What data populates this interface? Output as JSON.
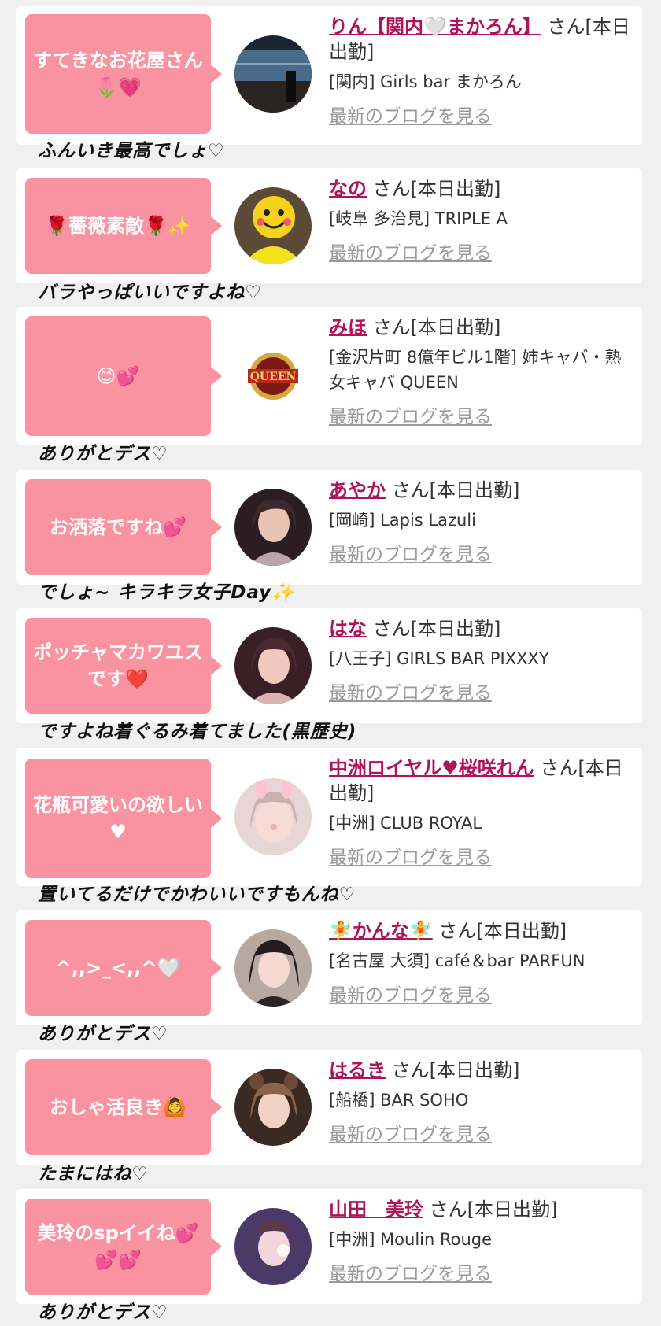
{
  "colors": {
    "bubble": "#f993a1",
    "name": "#b0135a",
    "link": "#9a9a9a",
    "card": "#ffffff",
    "background": "#f0f0f0"
  },
  "entries": [
    {
      "comment": "すてきなお花屋さん🌷💗",
      "name": "りん【関内🤍まかろん】",
      "suffix": "さん[本日出勤]",
      "shop": "[関内] Girls bar まかろん",
      "blog_link": "最新のブログを見る",
      "reply": "ふんいき最高でしょ♡",
      "avatar_icon": "night-window-avatar-icon"
    },
    {
      "comment": "🌹薔薇素敵🌹✨",
      "name": "なの",
      "suffix": "さん[本日出勤]",
      "shop": "[岐阜 多治見] TRIPLE A",
      "blog_link": "最新のブログを見る",
      "reply": "バラやっぱいいですよね♡",
      "avatar_icon": "smiley-face-avatar-icon"
    },
    {
      "comment": "😊💕",
      "name": "みほ",
      "suffix": "さん[本日出勤]",
      "shop": "[金沢片町 8億年ビル1階] 姉キャバ・熟女キャバ QUEEN",
      "blog_link": "最新のブログを見る",
      "reply": "ありがとデス♡",
      "avatar_icon": "queen-logo-icon",
      "logo_text": "QUEEN"
    },
    {
      "comment": "お洒落ですね💕",
      "name": "あやか",
      "suffix": "さん[本日出勤]",
      "shop": "[岡崎] Lapis Lazuli",
      "blog_link": "最新のブログを見る",
      "reply": "でしょ~ キラキラ女子Day✨",
      "avatar_icon": "portrait-avatar-icon"
    },
    {
      "comment": "ポッチャマカワユスです❤️",
      "name": "はな",
      "suffix": "さん[本日出勤]",
      "shop": "[八王子] GIRLS BAR PIXXXY",
      "blog_link": "最新のブログを見る",
      "reply": "ですよね着ぐるみ着てました(黒歴史)",
      "avatar_icon": "portrait-avatar-icon"
    },
    {
      "comment": "花瓶可愛いの欲しい♥",
      "name": "中洲ロイヤル♥桜咲れん",
      "suffix": "さん[本日出勤]",
      "shop": "[中洲] CLUB ROYAL",
      "blog_link": "最新のブログを見る",
      "reply": "置いてるだけでかわいいですもんね♡",
      "avatar_icon": "bunny-filter-avatar-icon"
    },
    {
      "comment": "^,,>_<,,^🤍",
      "name": "🧚かんな🧚",
      "suffix": "さん[本日出勤]",
      "shop": "[名古屋 大須] café＆bar PARFUN",
      "blog_link": "最新のブログを見る",
      "reply": "ありがとデス♡",
      "avatar_icon": "portrait-avatar-icon"
    },
    {
      "comment": "おしゃ活良き🙆",
      "name": "はるき",
      "suffix": "さん[本日出勤]",
      "shop": "[船橋] BAR SOHO",
      "blog_link": "最新のブログを見る",
      "reply": "たまにはね♡",
      "avatar_icon": "portrait-avatar-icon"
    },
    {
      "comment": "美玲のspイイね💕💕💕",
      "name": "山田　美玲",
      "suffix": "さん[本日出勤]",
      "shop": "[中洲] Moulin Rouge",
      "blog_link": "最新のブログを見る",
      "reply": "ありがとデス♡",
      "avatar_icon": "portrait-avatar-icon"
    }
  ]
}
